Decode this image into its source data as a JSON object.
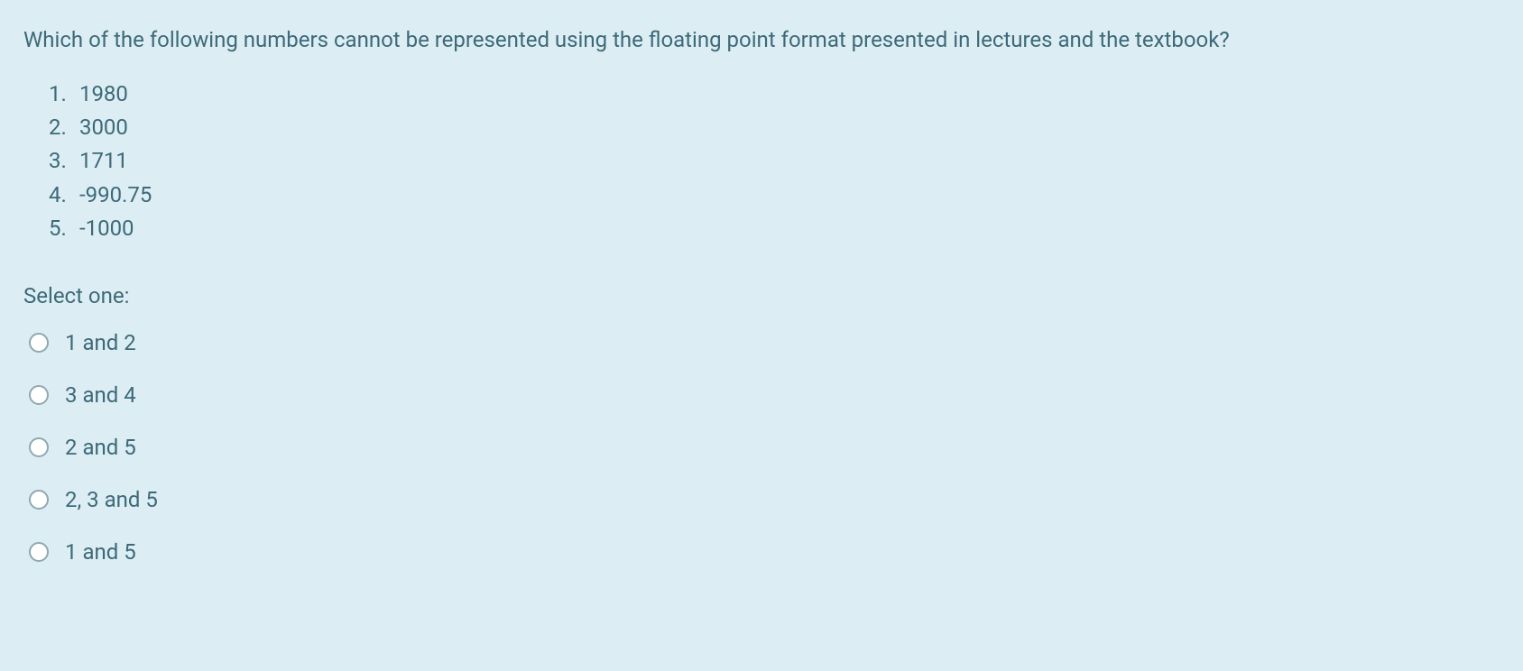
{
  "question": "Which of the following numbers cannot be represented using the floating point format presented in lectures and the textbook?",
  "numbers": [
    {
      "index": "1.",
      "value": "1980"
    },
    {
      "index": "2.",
      "value": "3000"
    },
    {
      "index": "3.",
      "value": "1711"
    },
    {
      "index": "4.",
      "value": "-990.75"
    },
    {
      "index": "5.",
      "value": "-1000"
    }
  ],
  "select_prompt": "Select one:",
  "options": [
    "1 and 2",
    "3 and 4",
    "2 and 5",
    "2, 3 and 5",
    "1 and 5"
  ]
}
